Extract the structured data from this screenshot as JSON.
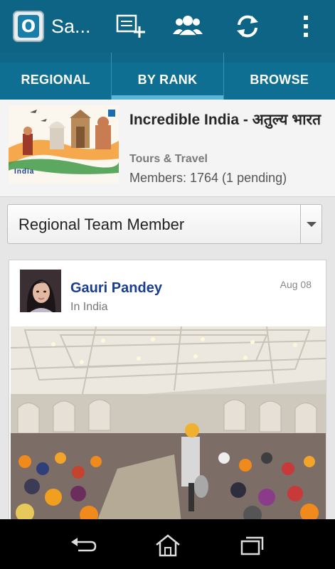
{
  "app": {
    "logo_letter": "O",
    "title": "Sa..."
  },
  "action_bar": {
    "icons": [
      "add-photo-icon",
      "community-icon",
      "refresh-icon",
      "overflow-menu-icon"
    ]
  },
  "tabs": [
    {
      "label": "REGIONAL",
      "active": false
    },
    {
      "label": "BY RANK",
      "active": true
    },
    {
      "label": "BROWSE",
      "active": false
    }
  ],
  "group": {
    "name": "Incredible India - अतुल्य भारत",
    "category": "Tours & Travel",
    "members": "Members: 1764 (1 pending)",
    "thumb_caption": "India"
  },
  "filter": {
    "selected": "Regional Team Member"
  },
  "post": {
    "author": "Gauri Pandey",
    "location": "In India",
    "date": "Aug 08"
  },
  "colors": {
    "action_bar": "#0d6484",
    "tab_bar": "#0f6f93",
    "tab_indicator": "#5bb5d6",
    "author_link": "#1a3d8f"
  },
  "nav": [
    "back-icon",
    "home-icon",
    "recent-apps-icon"
  ]
}
